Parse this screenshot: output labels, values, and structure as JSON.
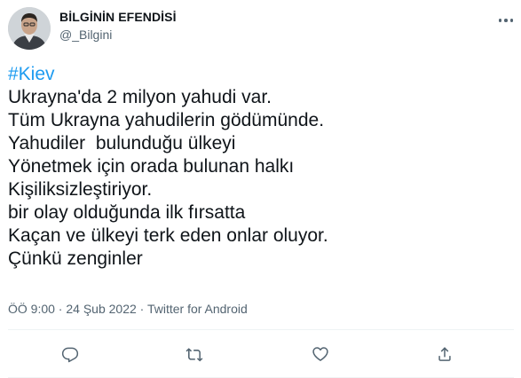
{
  "tweet": {
    "author": {
      "display_name": "BİLGİNİN EFENDİSİ",
      "handle": "@_Bilgini",
      "avatar_icon": "profile-photo"
    },
    "more_icon": "more-horizontal-icon",
    "hashtag": "#Kiev",
    "lines": [
      "Ukrayna'da 2 milyon yahudi var.",
      "Tüm Ukrayna yahudilerin gödümünde.",
      "Yahudiler  bulunduğu ülkeyi",
      "Yönetmek için orada bulunan halkı",
      "Kişiliksizleştiriyor.",
      "bir olay olduğunda ilk fırsatta",
      "Kaçan ve ülkeyi terk eden onlar oluyor.",
      "Çünkü zenginler"
    ],
    "meta": "ÖÖ 9:00 · 24 Şub 2022 · Twitter for Android",
    "actions": [
      {
        "name": "reply",
        "icon": "reply-icon"
      },
      {
        "name": "retweet",
        "icon": "retweet-icon"
      },
      {
        "name": "like",
        "icon": "heart-icon"
      },
      {
        "name": "share",
        "icon": "share-icon"
      }
    ],
    "colors": {
      "text": "#0f1419",
      "secondary": "#536471",
      "link": "#1d9bf0",
      "divider": "#eff3f4"
    }
  }
}
